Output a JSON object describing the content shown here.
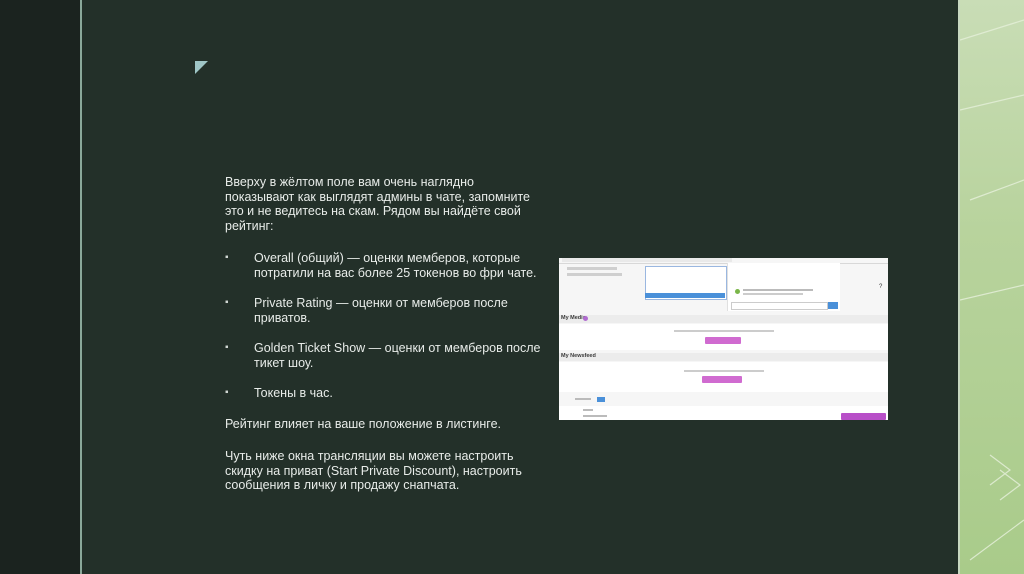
{
  "intro": "Вверху в жёлтом поле вам очень наглядно показывают как выглядят админы в чате, запомните это и не ведитесь на скам. Рядом вы найдёте свой рейтинг:",
  "bullets": [
    "Overall (общий) — оценки мемберов, которые потратили на вас более 25 токенов во фри чате.",
    "Private Rating — оценки от мемберов после приватов.",
    "Golden Ticket Show — оценки от мемберов после тикет шоу.",
    "Токены в час."
  ],
  "listing_note": "Рейтинг влияет на ваше положение в листинге.",
  "discount_note": "Чуть ниже окна трансляции вы можете настроить скидку на приват (Start Private Discount), настроить сообщения в личку и продажу снапчата.",
  "screenshot": {
    "my_media": "My Media",
    "my_newsfeed": "My Newsfeed",
    "accent_pink": "#d06bd0",
    "accent_blue": "#4a90d9"
  }
}
